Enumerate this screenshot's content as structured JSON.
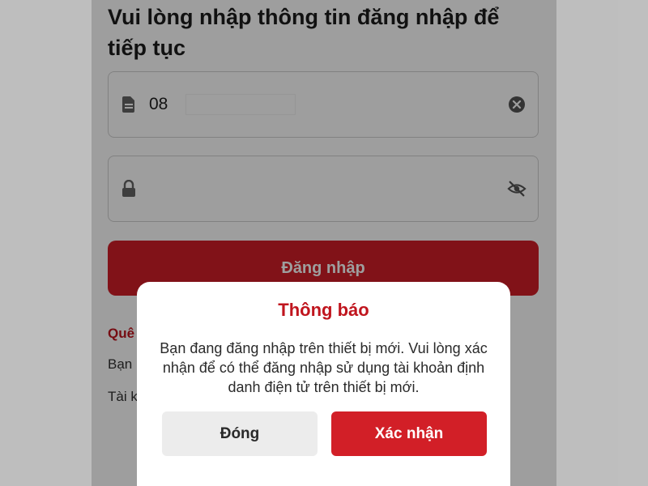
{
  "login": {
    "heading": "Vui lòng nhập thông tin đăng nhập để tiếp tục",
    "phone_value": "08",
    "login_button": "Đăng nhập",
    "forgot_partial": "Quê",
    "info_line1_partial": "Bạn",
    "info_line2_partial": "Tài k"
  },
  "dialog": {
    "title": "Thông báo",
    "message": "Bạn đang đăng nhập trên thiết bị mới. Vui lòng xác nhận để có thể đăng nhập sử dụng tài khoản định danh điện tử trên thiết bị mới.",
    "close_label": "Đóng",
    "confirm_label": "Xác nhận"
  },
  "icons": {
    "phone_field": "sim-card-icon",
    "clear": "clear-circle-icon",
    "password_field": "lock-icon",
    "visibility": "eye-off-icon"
  },
  "colors": {
    "brand_red": "#d21f27",
    "title_red": "#c0151e"
  }
}
